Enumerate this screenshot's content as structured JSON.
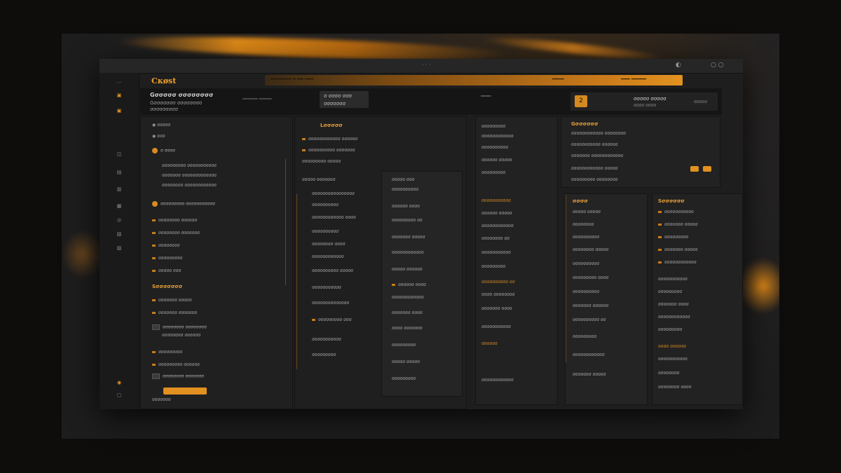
{
  "colors": {
    "accent": "#e3921f",
    "background": "#1e1e1e",
    "panel": "#232323"
  },
  "titlebar": {
    "title": "· · ·",
    "controls": [
      "◐",
      "○ ○"
    ]
  },
  "rail": {
    "items": [
      {
        "label": "···",
        "accent": false
      },
      {
        "label": "▣",
        "accent": true
      },
      {
        "label": "▣",
        "accent": true
      },
      {
        "label": "◫",
        "accent": false
      },
      {
        "label": "▤",
        "accent": false
      },
      {
        "label": "▥",
        "accent": false
      },
      {
        "label": "▦",
        "accent": false
      },
      {
        "label": "◎",
        "accent": false
      },
      {
        "label": "▧",
        "accent": false
      },
      {
        "label": "▨",
        "accent": false
      },
      {
        "label": "◉",
        "accent": true
      },
      {
        "label": "▢",
        "accent": false
      }
    ]
  },
  "topbar": {
    "brand": "Cкøst",
    "bar_left": "━━━━━━━ ━ ━━ ━━━",
    "bar_center": "━━━━",
    "bar_right": "━━━ ━━━━━"
  },
  "header": {
    "title": "Gσσσσσ σσσσσσσσ",
    "subtitle": "Gσσσσσσσ σσσσσσσσ",
    "subtitle2": "σσσσσσσσσ",
    "meta": "━━━━━━ ━━━━━",
    "tile_a": "σ σσσσ σσσ",
    "tile_b": "σσσσσσσ",
    "mid": "━━━━",
    "stat_num": "2",
    "stat_t1": "σσσσσ σσσσσ",
    "stat_t2": "σσσσ σσσσ",
    "stat_t3": "σσσσσ"
  },
  "left_list": {
    "items": [
      "◉ σσσσσ",
      "◉ σσσ",
      "σ σσσσ",
      "σσσσσσσσσ σσσσσσσσσσσ",
      "σσσσσσσ σσσσσσσσσσσσσ",
      "σσσσσσσσ σσσσσσσσσσσσ",
      "σσσσσσσσσ σσσσσσσσσσσ",
      "σσσσσσσσ σσσσσσ",
      "σσσσσσσσ σσσσσσσ",
      "σσσσσσσσ",
      "σσσσσσσσσ",
      "σσσσσ σσσ"
    ],
    "section": "Sσσσσσσσ",
    "items2": [
      "σσσσσσσ σσσσσ",
      "σσσσσσσ σσσσσσσ",
      "σσσσσσσσ σσσσσσσσ",
      "σσσσσσσσ σσσσσσ",
      "σσσσσσσσσ",
      "σσσσσσσσσ σσσσσσ",
      "σσσσσσσσ σσσσσσσ",
      "σσσσσσσ"
    ]
  },
  "col1": {
    "title": "Lσσσσσ",
    "lines": [
      "σσσσσσσσσσσσ σσσσσσ",
      "σσσσσσσσσσ σσσσσσσ",
      "σσσσσσσσσ σσσσσ",
      "σσσσσ σσσσσσσ",
      "σσσσσσσσσσσσσσσσ",
      "σσσσσσσσσσ",
      "σσσσσσσσσσσσ σσσσ",
      "σσσσσσσσσσ",
      "σσσσσσσσ σσσσ",
      "σσσσσσσσσσσσ",
      "σσσσσσσσσσ σσσσσ",
      "σσσσσσσσσσσ",
      "σσσσσσσσσσσσσσ",
      "σσσσσσσσσ σσσ",
      "σσσσσσσσσσσ",
      "σσσσσσσσσ"
    ]
  },
  "col2": {
    "lines": [
      "σσσσσ σσσ",
      "σσσσσσσσσσ",
      "σσσσσσ σσσσ",
      "σσσσσσσσσ σσ",
      "σσσσσσσ σσσσσ",
      "σσσσσσσσσσσσ",
      "σσσσσ σσσσσσ",
      "σσσσσσ σσσσ",
      "σσσσσσσσσσσσ",
      "σσσσσσσ σσσσ",
      "σσσσ σσσσσσσ",
      "σσσσσσσσσ",
      "σσσσσ σσσσσ",
      "σσσσσσσσσ"
    ]
  },
  "col3": {
    "lines": [
      "σσσσσσσσσ",
      "σσσσσσσσσσσσ",
      "σσσσσσσσσσ",
      "σσσσσσ σσσσσ",
      "σσσσσσσσσ",
      "σσσσσσσσσσσ",
      "σσσσσσ σσσσσ",
      "σσσσσσσσσσσσ",
      "σσσσσσσσ σσ",
      "σσσσσσσσσσσ",
      "σσσσσσσσσ",
      "σσσσσσσσσσ σσ",
      "σσσσ σσσσσσσσ",
      "σσσσσσσ σσσσ",
      "σσσσσσσσσσσ",
      "σσσσσσ",
      "σσσσσσσσσσσσ"
    ]
  },
  "col4": {
    "title": "Gσσσσσσ",
    "lines": [
      "σσσσσσσσσσσσ σσσσσσσσ",
      "σσσσσσσσσσσ σσσσσσ",
      "σσσσσσσ σσσσσσσσσσσσ",
      "σσσσσσσσσσσσ σσσσσ",
      "σσσσσσσσσ σσσσσσσσ",
      "σσσσ",
      "σσσσσ σσσσσ",
      "σσσσσσσσ",
      "σσσσσσσσσσ",
      "σσσσσσσσ σσσσσ",
      "σσσσσσσσσσ",
      "σσσσσσσσσ σσσσ",
      "σσσσσσσσσσ",
      "σσσσσσσ σσσσσσ",
      "σσσσσσσσσσ σσ",
      "σσσσσσσσσ",
      "σσσσσσσσσσσσ",
      "σσσσσσσ σσσσσ"
    ]
  },
  "col5": {
    "title": "Sσσσσσσ",
    "lines": [
      "σσσσσσσσσσσ",
      "σσσσσσσ σσσσσ",
      "σσσσσσσσσ",
      "σσσσσσσ σσσσσ",
      "σσσσσσσσσσσσ",
      "σσσσσσσσσσσ",
      "σσσσσσσσσ",
      "σσσσσσσ σσσσ",
      "σσσσσσσσσσσσ",
      "σσσσσσσσσ",
      "σσσσ σσσσσσ",
      "σσσσσσσσσσσ",
      "σσσσσσσσ",
      "σσσσσσσσ σσσσ"
    ]
  }
}
